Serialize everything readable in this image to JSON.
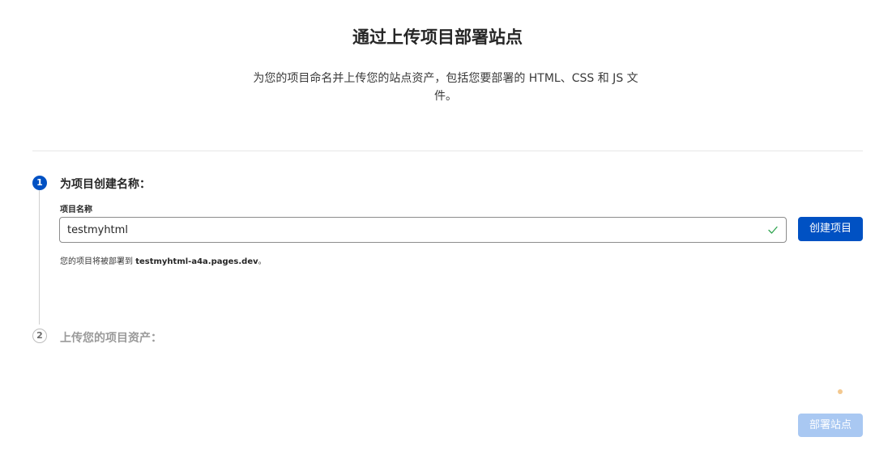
{
  "hero": {
    "title": "通过上传项目部署站点",
    "description": "为您的项目命名并上传您的站点资产，包括您要部署的 HTML、CSS 和 JS 文件。"
  },
  "steps": [
    {
      "number": "1",
      "title": "为项目创建名称：",
      "state": "active"
    },
    {
      "number": "2",
      "title": "上传您的项目资产：",
      "state": "inactive"
    }
  ],
  "project_form": {
    "label": "项目名称",
    "value": "testmyhtml",
    "validation_icon": "check-icon",
    "create_button": "创建项目",
    "hint_prefix": "您的项目将被部署到 ",
    "hint_domain": "testmyhtml-a4a.pages.dev",
    "hint_suffix": "。"
  },
  "footer": {
    "deploy_button": "部署站点"
  },
  "colors": {
    "accent": "#0051c3",
    "disabled_button": "#a9c8f2",
    "valid": "#2ea44f"
  }
}
